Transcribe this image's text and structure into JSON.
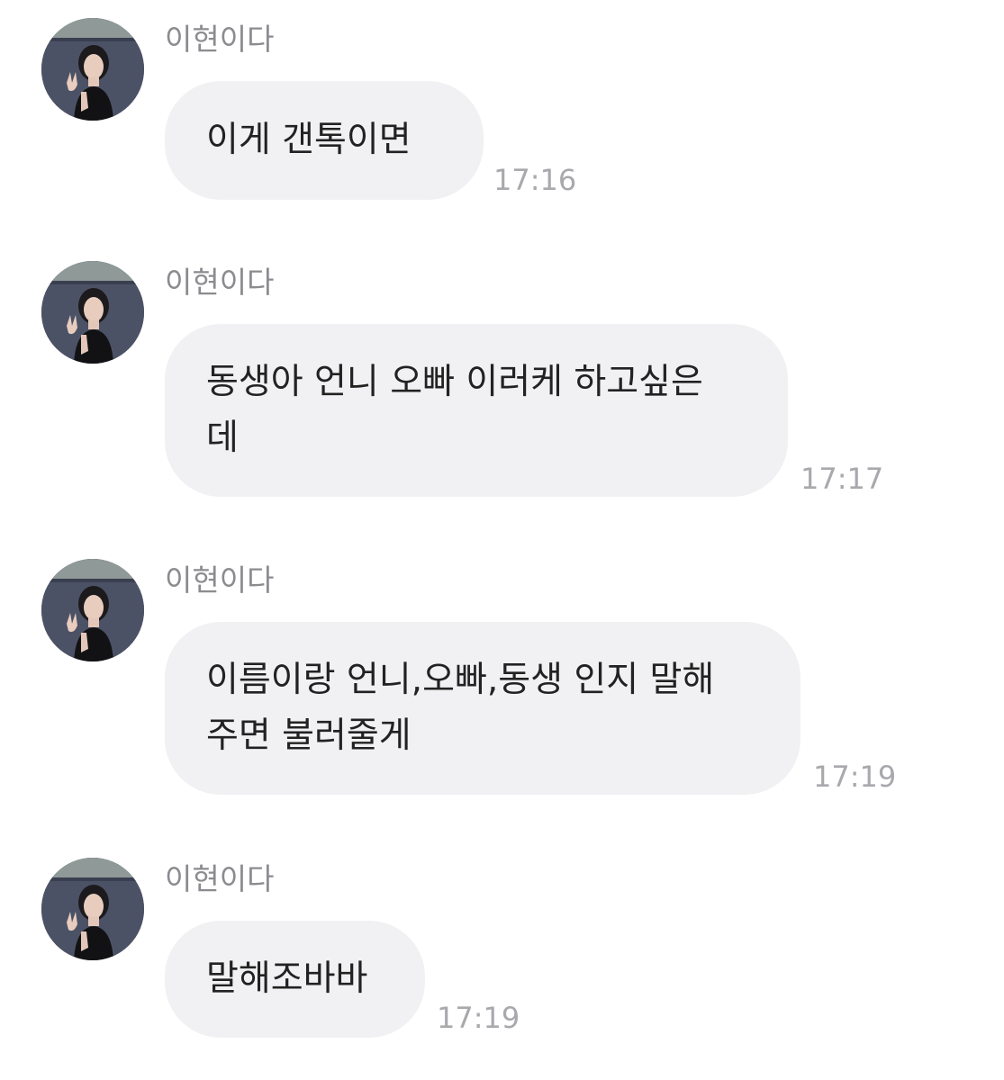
{
  "messages": [
    {
      "sender": "이현이다",
      "text": "이게 갠톡이면",
      "time": "17:16"
    },
    {
      "sender": "이현이다",
      "text": "동생아 언니 오빠 이러케 하고싶은\n데",
      "time": "17:17"
    },
    {
      "sender": "이현이다",
      "text": "이름이랑 언니,오빠,동생 인지 말해\n주면 불러줄게",
      "time": "17:19"
    },
    {
      "sender": "이현이다",
      "text": "말해조바바",
      "time": "17:19"
    }
  ],
  "colors": {
    "bubble": "#f1f1f3",
    "sender": "#8b8b90",
    "time": "#a8a8ad",
    "text": "#222222"
  },
  "icons": {
    "avatar": "profile-photo"
  }
}
